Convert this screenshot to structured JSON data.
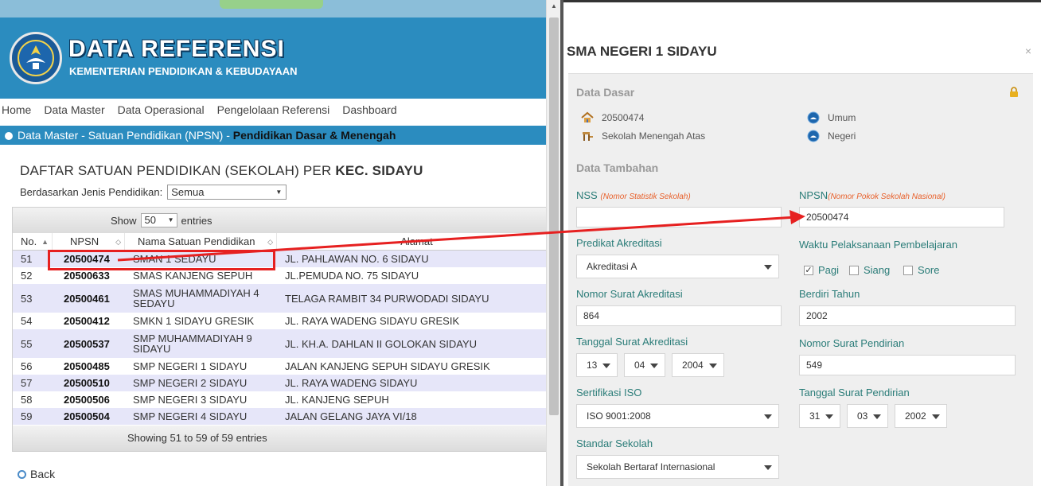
{
  "header": {
    "title": "DATA REFERENSI",
    "subtitle": "KEMENTERIAN PENDIDIKAN & KEBUDAYAAN"
  },
  "menu": [
    "Home",
    "Data Master",
    "Data Operasional",
    "Pengelolaan Referensi",
    "Dashboard"
  ],
  "breadcrumb": {
    "path": "Data Master - Satuan Pendidikan (NPSN) - ",
    "current": "Pendidikan Dasar & Menengah"
  },
  "list": {
    "title": "DAFTAR SATUAN PENDIDIKAN (SEKOLAH) PER ",
    "title_bold": "KEC. SIDAYU",
    "filter_label": "Berdasarkan Jenis Pendidikan:",
    "filter_value": "Semua",
    "show_label": "Show",
    "show_value": "50",
    "entries_label": "entries",
    "columns": [
      "No.",
      "NPSN",
      "Nama Satuan Pendidikan",
      "Alamat"
    ],
    "rows": [
      {
        "no": "51",
        "npsn": "20500474",
        "nama": "SMAN 1 SEDAYU",
        "alamat": "JL. PAHLAWAN NO. 6 SIDAYU"
      },
      {
        "no": "52",
        "npsn": "20500633",
        "nama": "SMAS KANJENG SEPUH",
        "alamat": "JL.PEMUDA NO. 75 SIDAYU"
      },
      {
        "no": "53",
        "npsn": "20500461",
        "nama": "SMAS MUHAMMADIYAH 4 SEDAYU",
        "alamat": "TELAGA RAMBIT 34 PURWODADI SIDAYU"
      },
      {
        "no": "54",
        "npsn": "20500412",
        "nama": "SMKN 1 SIDAYU GRESIK",
        "alamat": "JL. RAYA WADENG SIDAYU GRESIK"
      },
      {
        "no": "55",
        "npsn": "20500537",
        "nama": "SMP MUHAMMADIYAH 9 SIDAYU",
        "alamat": "JL. KH.A. DAHLAN II GOLOKAN SIDAYU"
      },
      {
        "no": "56",
        "npsn": "20500485",
        "nama": "SMP NEGERI 1 SIDAYU",
        "alamat": "JALAN KANJENG SEPUH SIDAYU GRESIK"
      },
      {
        "no": "57",
        "npsn": "20500510",
        "nama": "SMP NEGERI 2 SIDAYU",
        "alamat": "JL. RAYA WADENG SIDAYU"
      },
      {
        "no": "58",
        "npsn": "20500506",
        "nama": "SMP NEGERI 3 SIDAYU",
        "alamat": "JL. KANJENG SEPUH"
      },
      {
        "no": "59",
        "npsn": "20500504",
        "nama": "SMP NEGERI 4 SIDAYU",
        "alamat": "JALAN GELANG JAYA VI/18"
      }
    ],
    "footer": "Showing 51 to 59 of 59 entries",
    "back_label": "Back"
  },
  "modal": {
    "title": "SMA NEGERI 1 SIDAYU",
    "close": "×",
    "section_basic": "Data Dasar",
    "section_extra": "Data Tambahan",
    "basic": {
      "npsn": "20500474",
      "jenjang": "Sekolah Menengah Atas",
      "jenis": "Umum",
      "status": "Negeri"
    },
    "fields": {
      "nss_label": "NSS",
      "nss_hint": "(Nomor Statistik Sekolah)",
      "nss_value": "",
      "npsn_label": "NPSN",
      "npsn_hint": "(Nomor Pokok Sekolah Nasional)",
      "npsn_value": "20500474",
      "akreditasi_label": "Predikat Akreditasi",
      "akreditasi_value": "Akreditasi A",
      "waktu_label": "Waktu Pelaksanaan Pembelajaran",
      "waktu_options": [
        "Pagi",
        "Siang",
        "Sore"
      ],
      "waktu_checked": [
        true,
        false,
        false
      ],
      "no_surat_akr_label": "Nomor Surat Akreditasi",
      "no_surat_akr_value": "864",
      "berdiri_label": "Berdiri Tahun",
      "berdiri_value": "2002",
      "tgl_akr_label": "Tanggal Surat Akreditasi",
      "tgl_akr_day": "13",
      "tgl_akr_month": "04",
      "tgl_akr_year": "2004",
      "no_surat_pend_label": "Nomor Surat Pendirian",
      "no_surat_pend_value": "549",
      "iso_label": "Sertifikasi ISO",
      "iso_value": "ISO 9001:2008",
      "tgl_pend_label": "Tanggal Surat Pendirian",
      "tgl_pend_day": "31",
      "tgl_pend_month": "03",
      "tgl_pend_year": "2002",
      "standar_label": "Standar Sekolah",
      "standar_value": "Sekolah Bertaraf Internasional"
    }
  },
  "colors": {
    "header_blue": "#2b8cbf",
    "highlight_red": "#e62020",
    "label_teal": "#2a7c78",
    "hint_orange": "#e8612c"
  }
}
